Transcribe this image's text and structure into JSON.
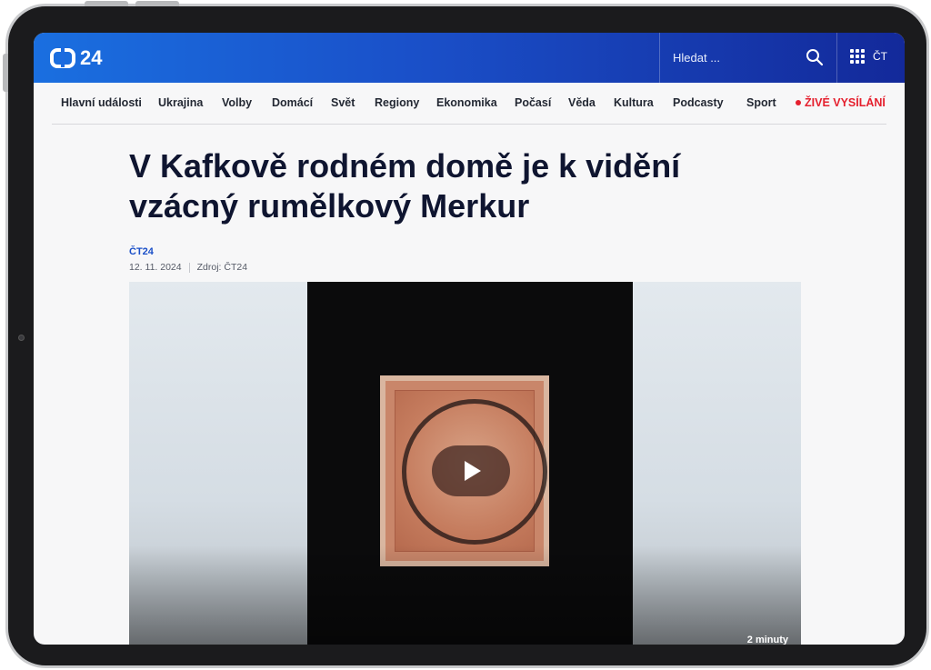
{
  "header": {
    "logo_text": "24",
    "search_placeholder": "Hledat ...",
    "apps_label": "ČT"
  },
  "nav": {
    "items": [
      "Hlavní události",
      "Ukrajina",
      "Volby",
      "Domácí",
      "Svět",
      "Regiony",
      "Ekonomika",
      "Počasí",
      "Věda",
      "Kultura",
      "Podcasty",
      "Sport"
    ],
    "live_label": "ŽIVÉ VYSÍLÁNÍ"
  },
  "article": {
    "title": "V Kafkově rodném domě je k vidění vzácný rumělkový Merkur",
    "source_link": "ČT24",
    "date": "12. 11. 2024",
    "source": "Zdroj: ČT24"
  },
  "video": {
    "duration": "2 minuty"
  },
  "colors": {
    "header_start": "#1a6fe0",
    "header_end": "#13299a",
    "live": "#e5202e",
    "link": "#1a4fc8"
  },
  "icons": [
    "search-icon",
    "apps-grid-icon",
    "play-icon",
    "live-dot-icon"
  ]
}
